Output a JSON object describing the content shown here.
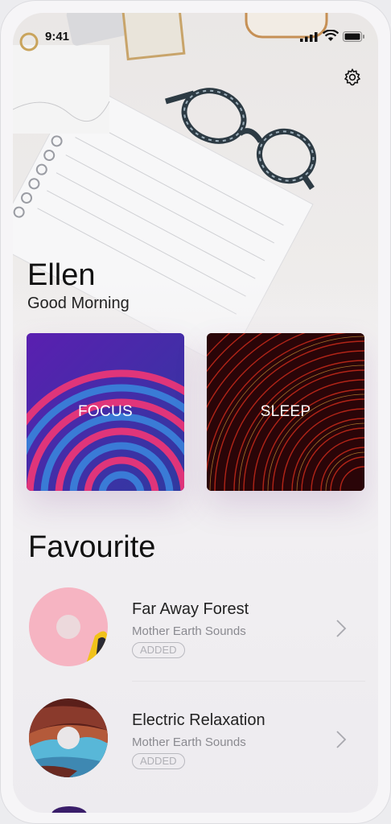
{
  "status_bar": {
    "time": "9:41"
  },
  "user": {
    "name": "Ellen",
    "greeting": "Good Morning"
  },
  "cards": [
    {
      "label": "FOCUS"
    },
    {
      "label": "SLEEP"
    }
  ],
  "favourites": {
    "title": "Favourite",
    "items": [
      {
        "title": "Far Away Forest",
        "artist": "Mother Earth Sounds",
        "badge": "ADDED"
      },
      {
        "title": "Electric Relaxation",
        "artist": "Mother Earth Sounds",
        "badge": "ADDED"
      }
    ]
  },
  "colors": {
    "focus_bg": "#4b1fa0",
    "focus_ring": "#e0357a",
    "sleep_bg": "#2a0508",
    "sleep_ring": "#c0281a",
    "thumb_pink": "#f6b4c2"
  },
  "icons": [
    "gear-icon",
    "signal-icon",
    "wifi-icon",
    "battery-icon",
    "chevron-right-icon"
  ]
}
